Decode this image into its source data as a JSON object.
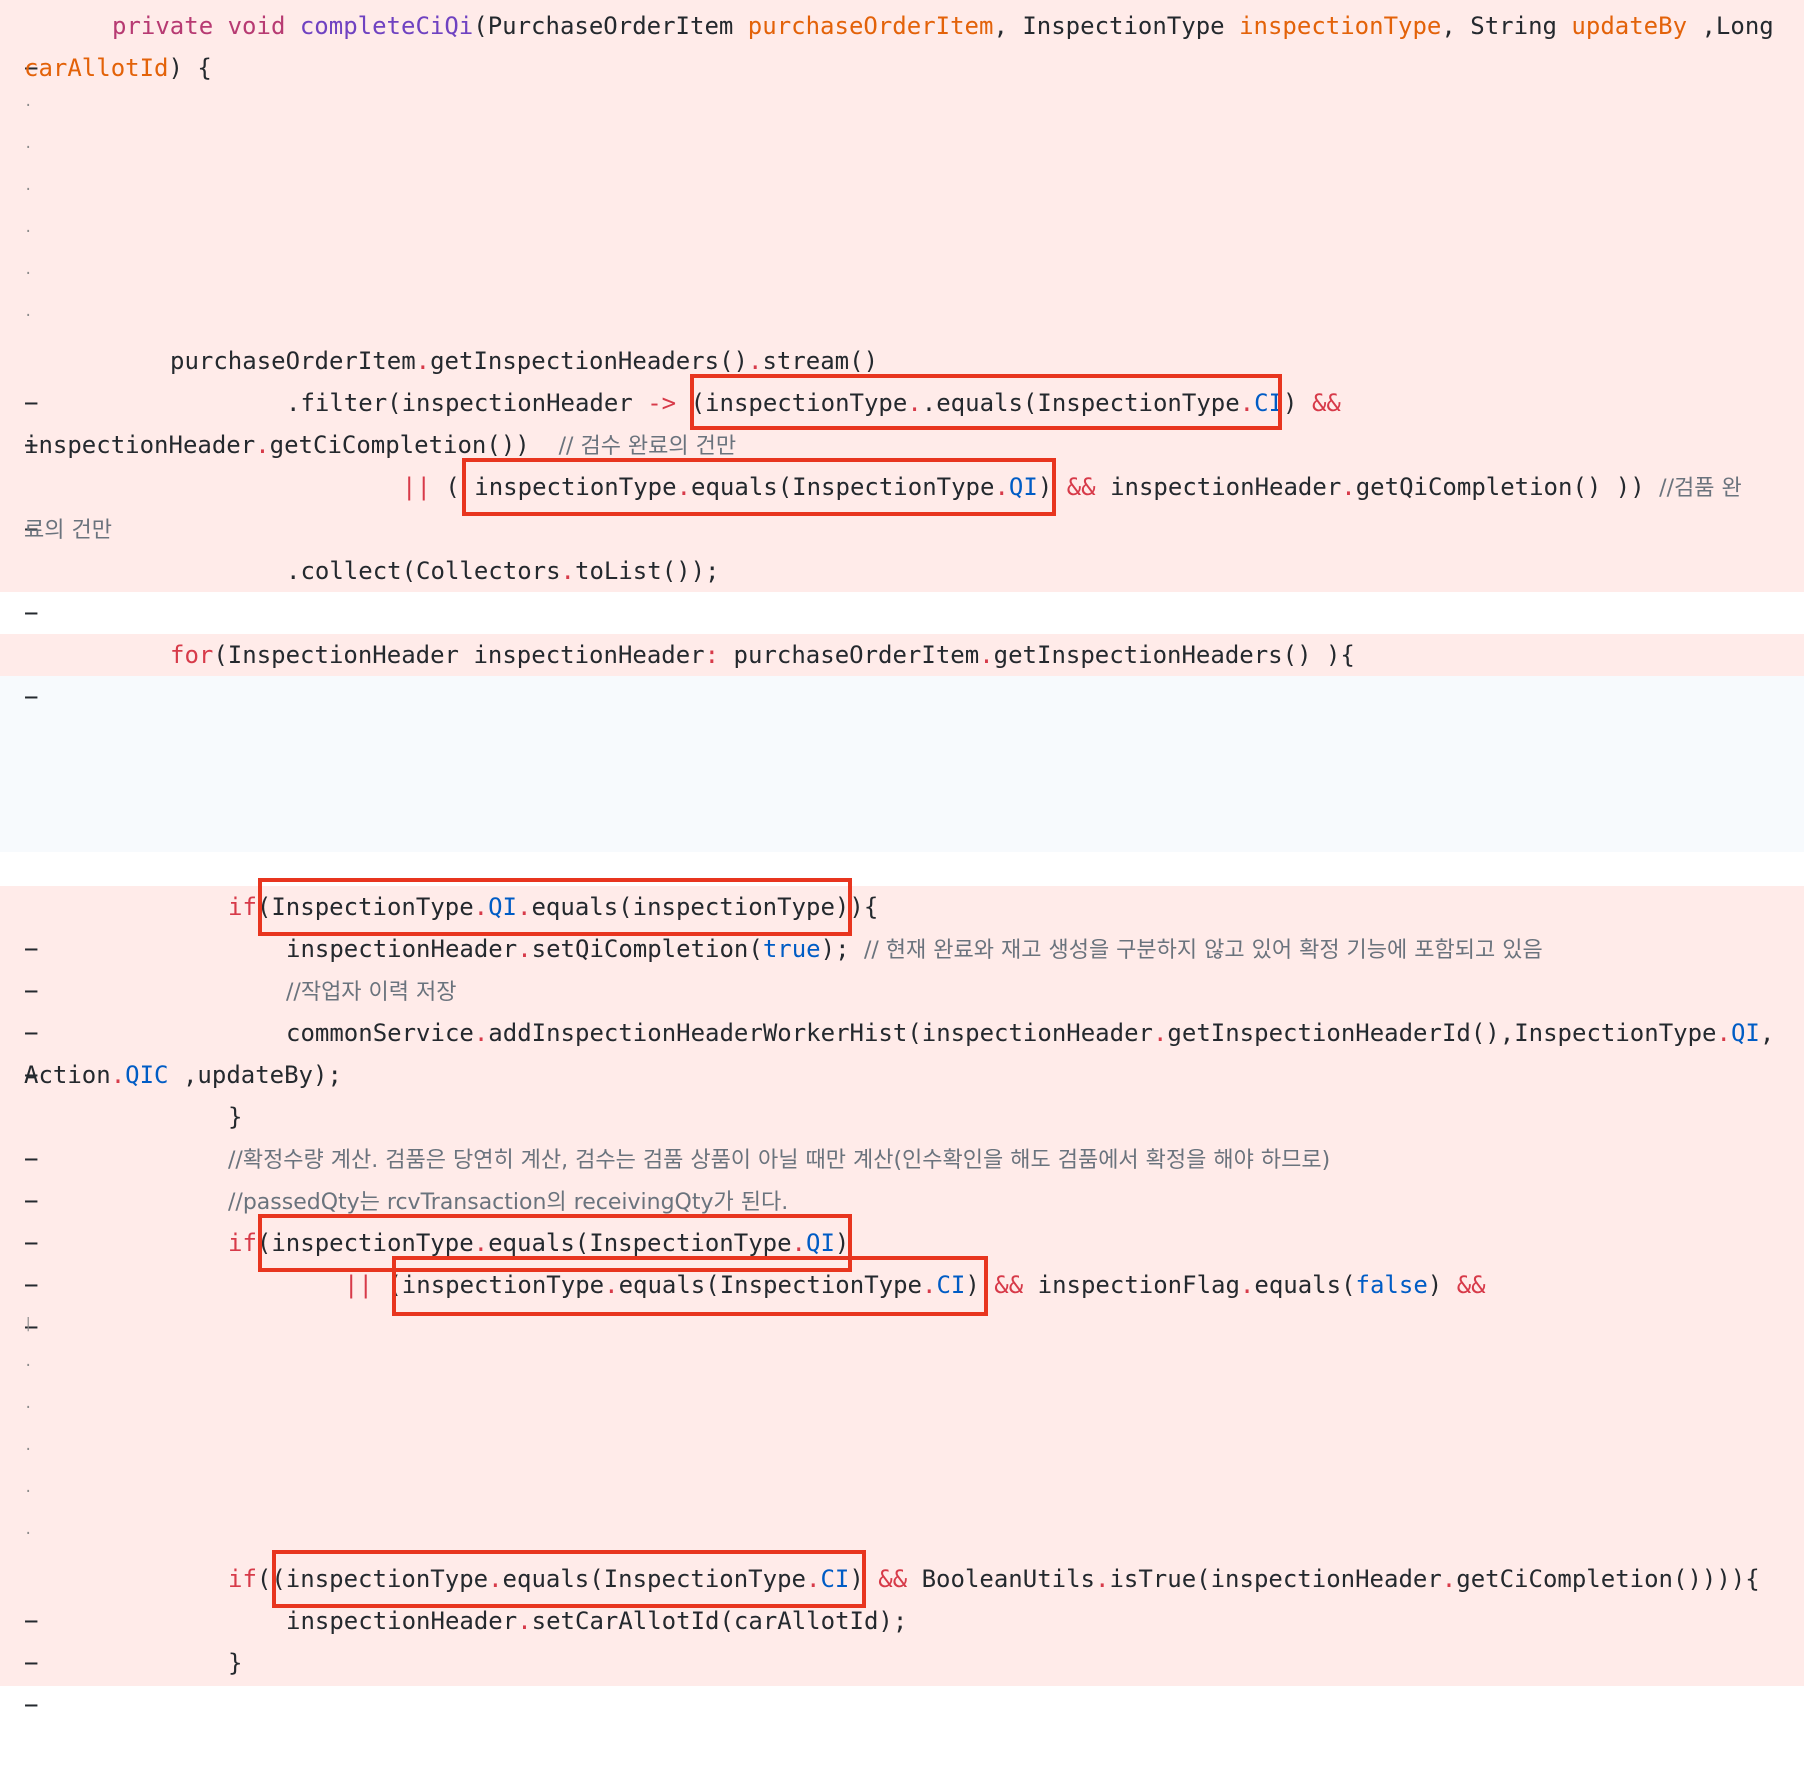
{
  "diff": {
    "marker": "−",
    "header": {
      "kw_private": "private",
      "kw_void": "void",
      "method": "completeCiQi",
      "p1": "(PurchaseOrderItem ",
      "p1n": "purchaseOrderItem",
      "p2": ", InspectionType ",
      "p2n": "inspectionType",
      "p3": ", String ",
      "p3n": "updateBy",
      "p4": " ,Long",
      "p4n": "carAllotId",
      "close": ") {"
    },
    "stream": {
      "l1a": "purchaseOrderItem",
      "l1b": ".",
      "l1c": "getInspectionHeaders()",
      "l1d": ".",
      "l1e": "stream()",
      "l2a": ".filter(inspectionHeader ",
      "l2arrow": "->",
      "l2b": " (inspectionType",
      "l2c": ".equals(InspectionType",
      "l2ci": "CI",
      "l2d": ")",
      "l2and": "&&",
      "l3a": "inspectionHeader",
      "l3b": "getCiCompletion())",
      "l3cm": "// 검수 완료의 건만",
      "l4or": "||",
      "l4a": "(",
      "l4b": "inspectionType",
      "l4c": "equals(InspectionType",
      "l4qi": "QI",
      "l4d": ")",
      "l4and": "&&",
      "l4e": "inspectionHeader",
      "l4f": "getQiCompletion() ))",
      "l4cm": "//검품 완",
      "l5cm": "료의 건만",
      "l6a": ".collect(Collectors",
      "l6b": "toList());"
    },
    "forloop": {
      "kw": "for",
      "a": "(InspectionHeader inspectionHeader",
      "colon": ":",
      "b": " purchaseOrderItem",
      "c": "getInspectionHeaders() ){"
    },
    "body": {
      "if1kw": "if",
      "if1a": "(InspectionType",
      "if1qi": "QI",
      "if1b": "equals(inspectionType))",
      "if1c": "{",
      "setqi_a": "inspectionHeader",
      "setqi_b": "setQiCompletion(",
      "setqi_true": "true",
      "setqi_c": ");",
      "setqi_cm": "// 현재 완료와 재고 생성을 구분하지 않고 있어 확정 기능에 포함되고 있음",
      "worker_cm": "//작업자 이력 저장",
      "common_a": "commonService",
      "common_b": "addInspectionHeaderWorkerHist(inspectionHeader",
      "common_c": "getInspectionHeaderId(),InspectionType",
      "common_qi": "QI",
      "common_d": ",",
      "action_a": "Action",
      "action_qic": "QIC",
      "action_b": " ,updateBy);",
      "brace1": "}",
      "calc_cm": "//확정수량 계산. 검품은 당연히 계산, 검수는 검품 상품이 아닐 때만 계산(인수확인을 해도 검품에서 확정을 해야 하므로)",
      "passed_cm": "//passedQty는 rcvTransaction의 receivingQty가 된다.",
      "if2kw": "if",
      "if2a": "(inspectionType",
      "if2b": "equals(InspectionType",
      "if2qi": "QI",
      "if2c": ")",
      "or2": "||",
      "or2a": "(inspectionType",
      "or2b": "equals(InspectionType",
      "or2ci": "CI",
      "or2c": ")",
      "or2and": "&&",
      "or2d": " inspectionFlag",
      "or2e": "equals(",
      "or2false": "false",
      "or2f": ")",
      "or2and2": "&&",
      "if3kw": "if",
      "if3a": "((inspectionType",
      "if3b": "equals(InspectionType",
      "if3ci": "CI",
      "if3c": ")",
      "if3and": "&&",
      "if3d": " BooleanUtils",
      "if3e": "isTrue(inspectionHeader",
      "if3f": "getCiCompletion()))){",
      "setcar_a": "inspectionHeader",
      "setcar_b": "setCarAllotId(carAllotId);",
      "brace2": "}"
    }
  }
}
